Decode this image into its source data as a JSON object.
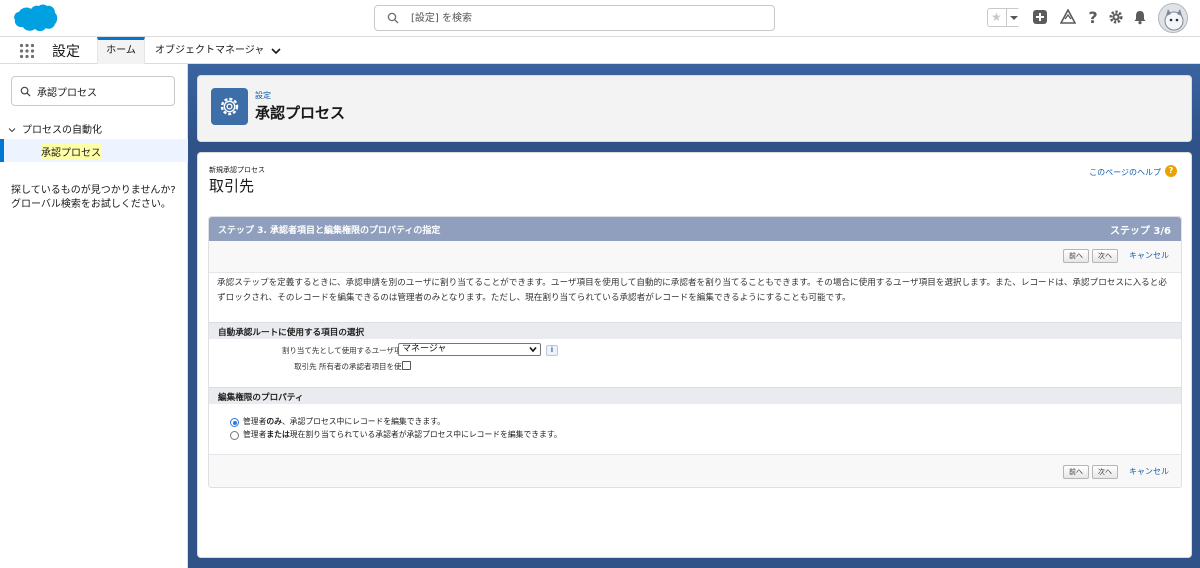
{
  "colors": {
    "brand": "#0176d3",
    "backdrop": "#2f5289",
    "wizard_header": "#8f9fbd",
    "highlight": "#ffffa8"
  },
  "global_search": {
    "placeholder": "[設定] を検索"
  },
  "header_icons": [
    "favorites-star-icon",
    "favorites-dropdown-icon",
    "global-add-icon",
    "trailhead-icon",
    "help-icon",
    "setup-gear-icon",
    "notifications-bell-icon",
    "user-avatar"
  ],
  "app_nav": {
    "app_name": "設定",
    "tabs": [
      {
        "label": "ホーム"
      },
      {
        "label": "オブジェクトマネージャ"
      }
    ]
  },
  "sidebar": {
    "quickfind_value": "承認プロセス",
    "tree_parent": "プロセスの自動化",
    "tree_child": "承認プロセス",
    "not_found_text": "探しているものが見つかりませんか? グローバル検索をお試しください。"
  },
  "page_header": {
    "eyebrow": "設定",
    "title": "承認プロセス"
  },
  "content": {
    "pre_title": "新規承認プロセス",
    "object_title": "取引先",
    "help_link": "このページのヘルプ",
    "help_icon_glyph": "?",
    "step_title": "ステップ 3. 承認者項目と編集権限のプロパティの指定",
    "step_count": "ステップ 3/6",
    "buttons": {
      "prev": "前へ",
      "next": "次へ",
      "cancel": "キャンセル"
    },
    "description": "承認ステップを定義するときに、承認申請を別のユーザに割り当てることができます。ユーザ項目を使用して自動的に承認者を割り当てることもできます。その場合に使用するユーザ項目を選択します。また、レコードは、承認プロセスに入ると必ずロックされ、そのレコードを編集できるのは管理者のみとなります。ただし、現在割り当てられている承認者がレコードを編集できるようにすることも可能です。",
    "section1_title": "自動承認ルートに使用する項目の選択",
    "field_user_label": "割り当て先として使用するユーザ項目",
    "field_user_value": "マネージャ",
    "info_glyph": "i",
    "field_checkbox_label": "取引先 所有者の承認者項目を使用",
    "field_checkbox_checked": false,
    "section2_title": "編集権限のプロパティ",
    "radio1_bold": "管理者のみ",
    "radio1_prefix": "管理者",
    "radio1_rest": "、承認プロセス中にレコードを編集できます。",
    "radio1_bold_part": "のみ",
    "radio2_prefix": "管理者",
    "radio2_bold_part": "または",
    "radio2_rest": "現在割り当てられている承認者が承認プロセス中にレコードを編集できます。",
    "selected_radio": 1
  }
}
